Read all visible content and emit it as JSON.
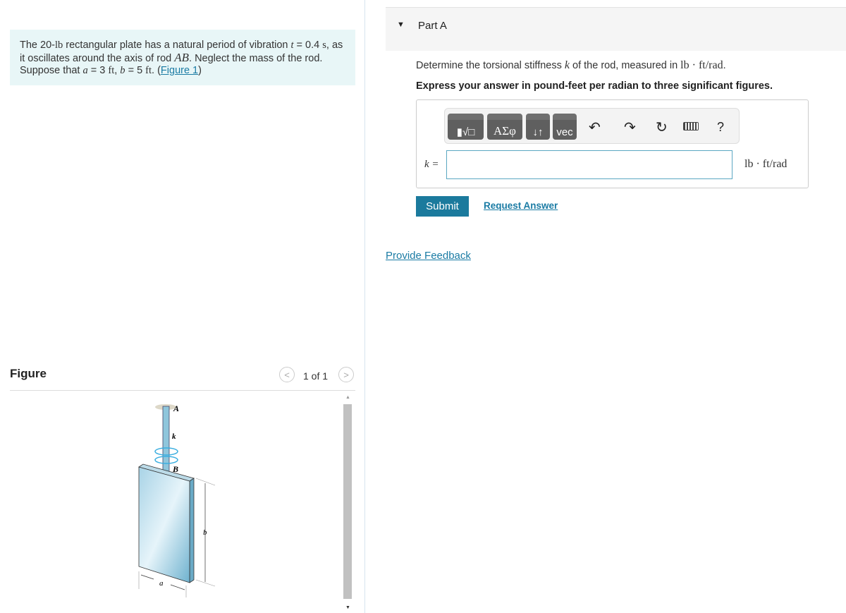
{
  "problem": {
    "text1": "The 20-",
    "lb": "lb",
    "text2": " rectangular plate has a natural period of vibration ",
    "t": "t",
    "text3": " = 0.4 ",
    "s": "s",
    "text4": ", as it oscillates around the axis of rod ",
    "ab": "AB",
    "text5": ". Neglect the mass of the rod. Suppose that ",
    "a": "a",
    "text6": " = 3 ",
    "ft1": "ft",
    "text7": ", ",
    "b": "b",
    "text8": " = 5 ",
    "ft2": "ft",
    "text9": ". (",
    "figure_link": "Figure 1",
    "text10": ")"
  },
  "figure": {
    "title": "Figure",
    "pager": "1 of 1",
    "prev": "<",
    "next": ">",
    "labels": {
      "A": "A",
      "k": "k",
      "B": "B",
      "b": "b",
      "a": "a"
    }
  },
  "part": {
    "title": "Part A",
    "question_pre": "Determine the torsional stiffness ",
    "k": "k",
    "question_mid": " of the rod, measured in ",
    "unit": "lb · ft/rad",
    "question_end": ".",
    "instruction": "Express your answer in pound-feet per radian to three significant figures."
  },
  "toolbar": {
    "templates": "▮√□",
    "greek": "ΑΣφ",
    "arrows": "↓↑",
    "vec": "vec",
    "undo": "undo-icon",
    "redo": "redo-icon",
    "reset": "reset-icon",
    "keyboard": "keyboard-icon",
    "help": "?"
  },
  "answer": {
    "label": "k =",
    "value": "",
    "unit": "lb · ft/rad"
  },
  "buttons": {
    "submit": "Submit",
    "request": "Request Answer",
    "feedback": "Provide Feedback"
  },
  "colors": {
    "accent": "#1b7a9d",
    "problem_bg": "#e8f6f7"
  }
}
